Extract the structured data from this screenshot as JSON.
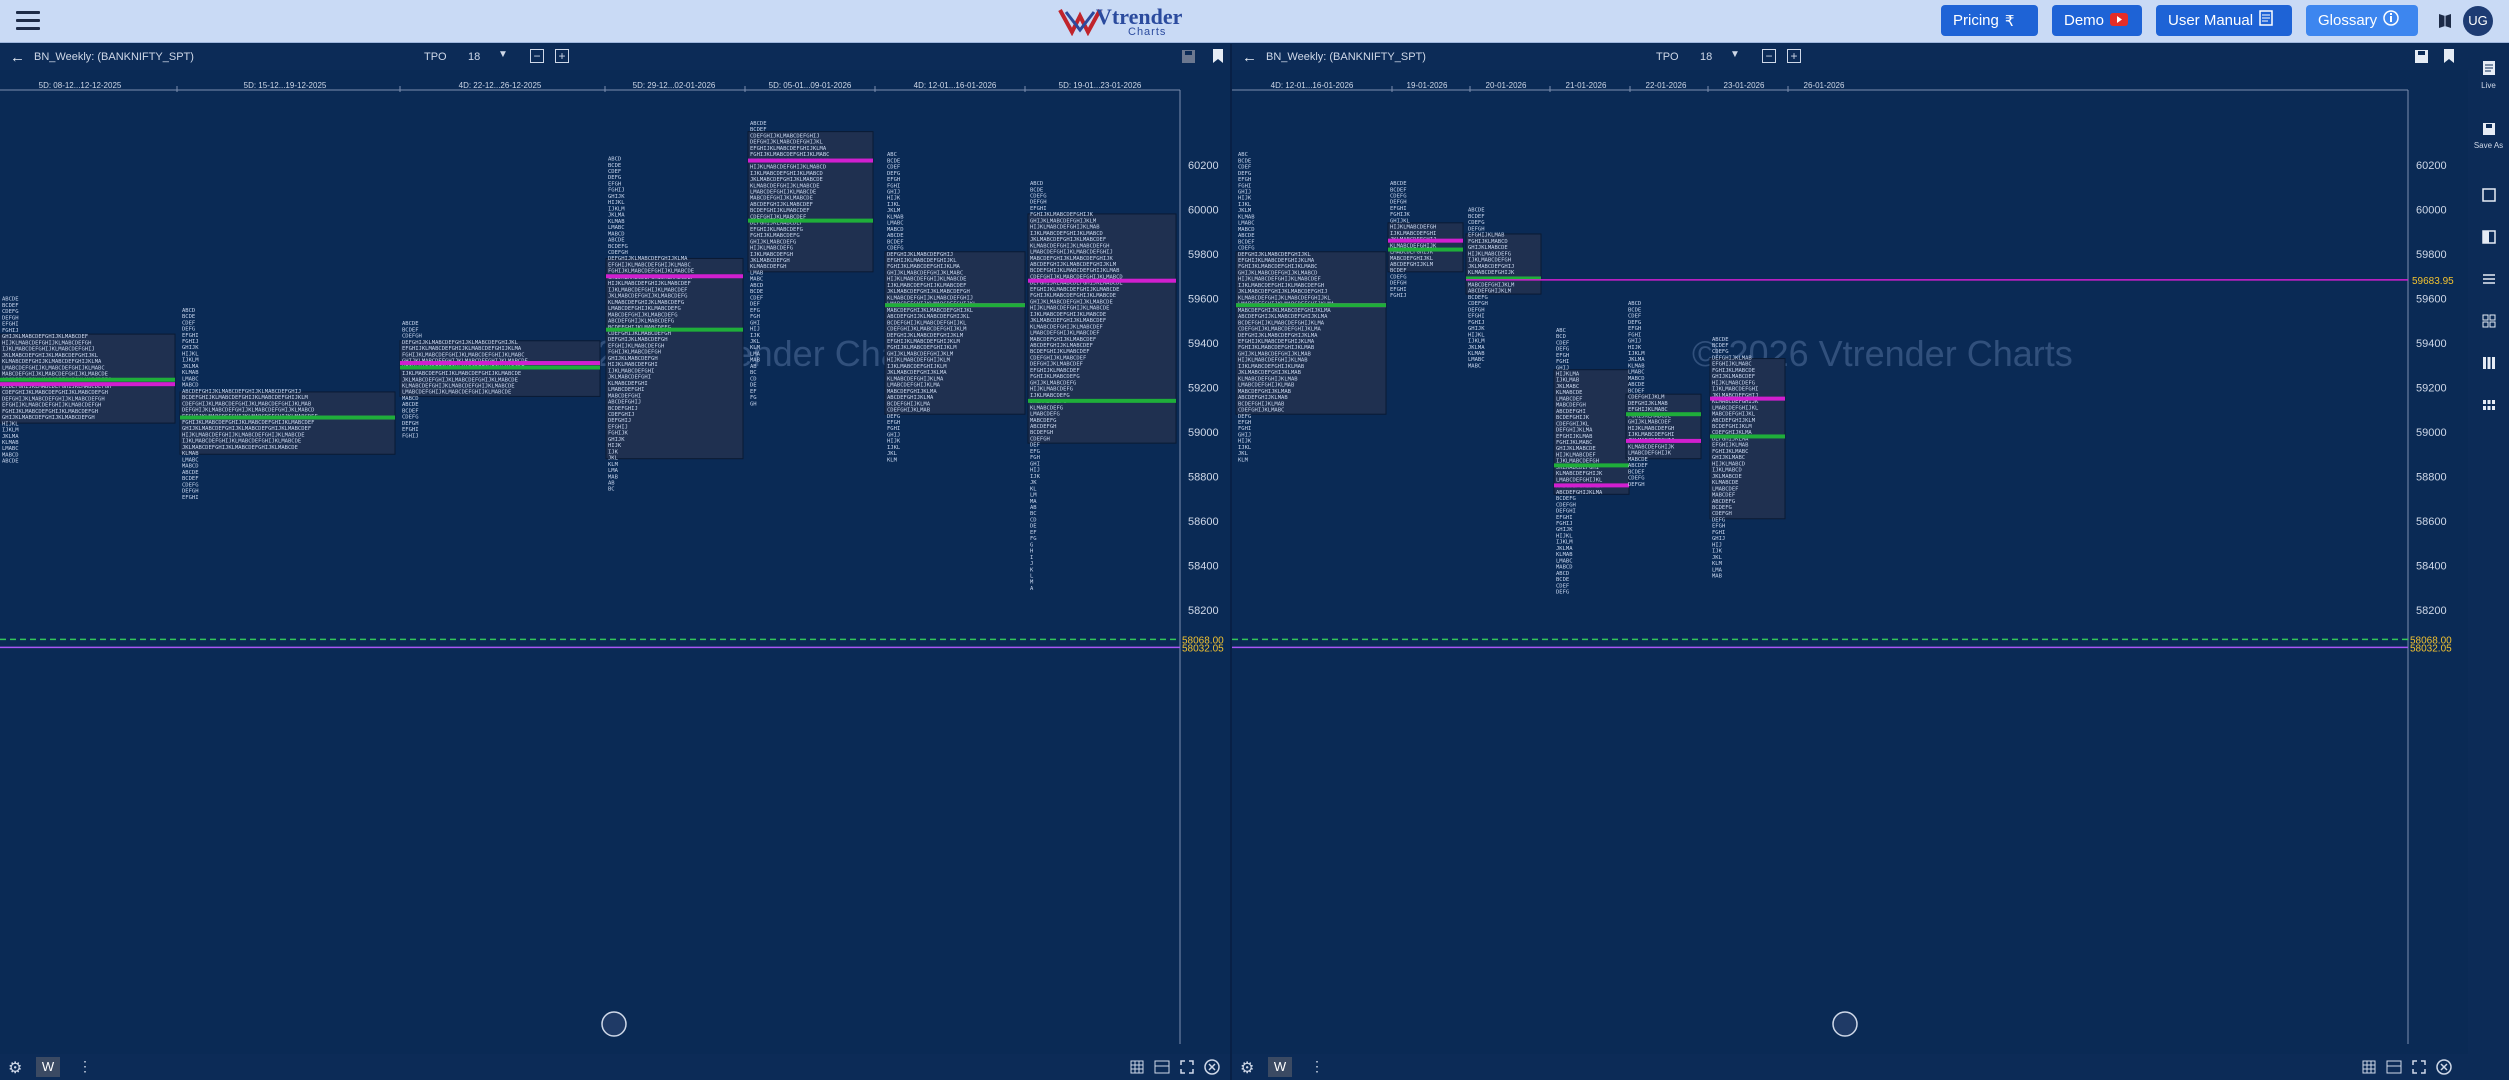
{
  "header": {
    "logo_text": "Vtrender",
    "logo_sub": "Charts",
    "buttons": [
      {
        "label": "Pricing",
        "icon": "rupee-icon"
      },
      {
        "label": "Demo",
        "icon": "youtube-icon"
      },
      {
        "label": "User Manual",
        "icon": "document-icon"
      },
      {
        "label": "Glossary",
        "icon": "info-icon"
      }
    ],
    "avatar_initials": "UG"
  },
  "watermark": "© 2026 Vtrender Charts",
  "left_panel": {
    "symbol": "BN_Weekly: (BANKNIFTY_SPT)",
    "tpo_label": "TPO",
    "tpo_value": "18",
    "date_labels": [
      "5D: 08-12...12-12-2025",
      "5D: 15-12...19-12-2025",
      "4D: 22-12...26-12-2025",
      "5D: 29-12...02-01-2026",
      "5D: 05-01...09-01-2026",
      "4D: 12-01...16-01-2026",
      "5D: 19-01...23-01-2026"
    ],
    "price_ticks": [
      "60200",
      "60000",
      "59800",
      "59600",
      "59400",
      "59200",
      "59000",
      "58800",
      "58600",
      "58400",
      "58200"
    ],
    "level_labels": [
      "58068.00",
      "58032.05"
    ],
    "timeframe": "W"
  },
  "right_panel": {
    "symbol": "BN_Weekly: (BANKNIFTY_SPT)",
    "tpo_label": "TPO",
    "tpo_value": "18",
    "date_labels": [
      "4D: 12-01...16-01-2026",
      "19-01-2026",
      "20-01-2026",
      "21-01-2026",
      "22-01-2026",
      "23-01-2026",
      "26-01-2026"
    ],
    "price_ticks": [
      "60200",
      "60000",
      "59800",
      "59600",
      "59400",
      "59200",
      "59000",
      "58800",
      "58600",
      "58400",
      "58200"
    ],
    "current_price": "59683.95",
    "level_labels": [
      "58068.00",
      "58032.05"
    ],
    "timeframe": "W"
  },
  "right_rail": [
    {
      "icon": "document-icon",
      "label": "Live"
    },
    {
      "icon": "save-icon",
      "label": "Save As"
    },
    {
      "icon": "square-layout-icon",
      "label": ""
    },
    {
      "icon": "split-layout-icon",
      "label": ""
    },
    {
      "icon": "rows-layout-icon",
      "label": ""
    },
    {
      "icon": "grid-2x2-icon",
      "label": ""
    },
    {
      "icon": "columns-layout-icon",
      "label": ""
    },
    {
      "icon": "grid-3x2-icon",
      "label": ""
    }
  ],
  "colors": {
    "background": "#0a2a55",
    "profile_box": "#1f3050",
    "poc": "#d11fcf",
    "value_line": "#1fae3a",
    "tpo_letters": "#c8d6ee",
    "current_price": "#d11fcf",
    "level_line": "#34c759",
    "accent": "#1e63d6"
  },
  "chart_data": [
    {
      "type": "tpo_profile",
      "panel": "left",
      "title": "BN_Weekly: (BANKNIFTY_SPT)",
      "y_ticks": [
        60200,
        60000,
        59800,
        59600,
        59400,
        59200,
        59000,
        58800,
        58600,
        58400,
        58200
      ],
      "ylim": [
        58000,
        60400
      ],
      "reference_levels": [
        58068.0,
        58032.05
      ],
      "profiles": [
        {
          "label": "5D: 08-12...12-12-2025",
          "high": 59590,
          "low": 58860,
          "va_high": 59440,
          "va_low": 59040,
          "poc": 59215,
          "green": 59235
        },
        {
          "label": "5D: 15-12...19-12-2025",
          "high": 59540,
          "low": 58700,
          "va_high": 59180,
          "va_low": 58900,
          "poc": 59065,
          "green": 59065
        },
        {
          "label": "4D: 22-12...26-12-2025",
          "high": 59480,
          "low": 58950,
          "va_high": 59410,
          "va_low": 59160,
          "poc": 59310,
          "green": 59290
        },
        {
          "label": "5D: 29-12...02-01-2026",
          "high": 60220,
          "low": 58730,
          "va_high": 59780,
          "va_low": 58880,
          "poc": 59700,
          "green": 59460
        },
        {
          "label": "5D: 05-01...09-01-2026",
          "high": 60380,
          "low": 59100,
          "va_high": 60350,
          "va_low": 59720,
          "poc": 60220,
          "green": 59950
        },
        {
          "label": "4D: 12-01...16-01-2026",
          "high": 60240,
          "low": 58860,
          "va_high": 59810,
          "va_low": 59080,
          "poc": 59570,
          "green": 59570
        },
        {
          "label": "5D: 19-01...23-01-2026",
          "high": 60110,
          "low": 58270,
          "va_high": 59980,
          "va_low": 58950,
          "poc": 59680,
          "green": 59140
        }
      ]
    },
    {
      "type": "tpo_profile",
      "panel": "right",
      "title": "BN_Weekly: (BANKNIFTY_SPT)",
      "y_ticks": [
        60200,
        60000,
        59800,
        59600,
        59400,
        59200,
        59000,
        58800,
        58600,
        58400,
        58200
      ],
      "ylim": [
        58000,
        60400
      ],
      "current_price": 59683.95,
      "reference_levels": [
        58068.0,
        58032.05
      ],
      "profiles": [
        {
          "label": "4D: 12-01...16-01-2026",
          "high": 60240,
          "low": 58860,
          "va_high": 59810,
          "va_low": 59080,
          "poc": 59570,
          "green": 59570
        },
        {
          "label": "19-01-2026",
          "high": 60110,
          "low": 59580,
          "va_high": 59940,
          "va_low": 59720,
          "poc": 59860,
          "green": 59820
        },
        {
          "label": "20-01-2026",
          "high": 59990,
          "low": 59270,
          "va_high": 59890,
          "va_low": 59620,
          "poc": 59690,
          "green": 59690
        },
        {
          "label": "21-01-2026",
          "high": 59450,
          "low": 58260,
          "va_high": 59280,
          "va_low": 58720,
          "poc": 58760,
          "green": 58850
        },
        {
          "label": "22-01-2026",
          "high": 59570,
          "low": 58750,
          "va_high": 59170,
          "va_low": 58880,
          "poc": 58960,
          "green": 59080
        },
        {
          "label": "23-01-2026",
          "high": 59410,
          "low": 58340,
          "va_high": 59330,
          "va_low": 58610,
          "poc": 59150,
          "green": 58980
        },
        {
          "label": "26-01-2026",
          "high": null,
          "low": null
        }
      ]
    }
  ]
}
